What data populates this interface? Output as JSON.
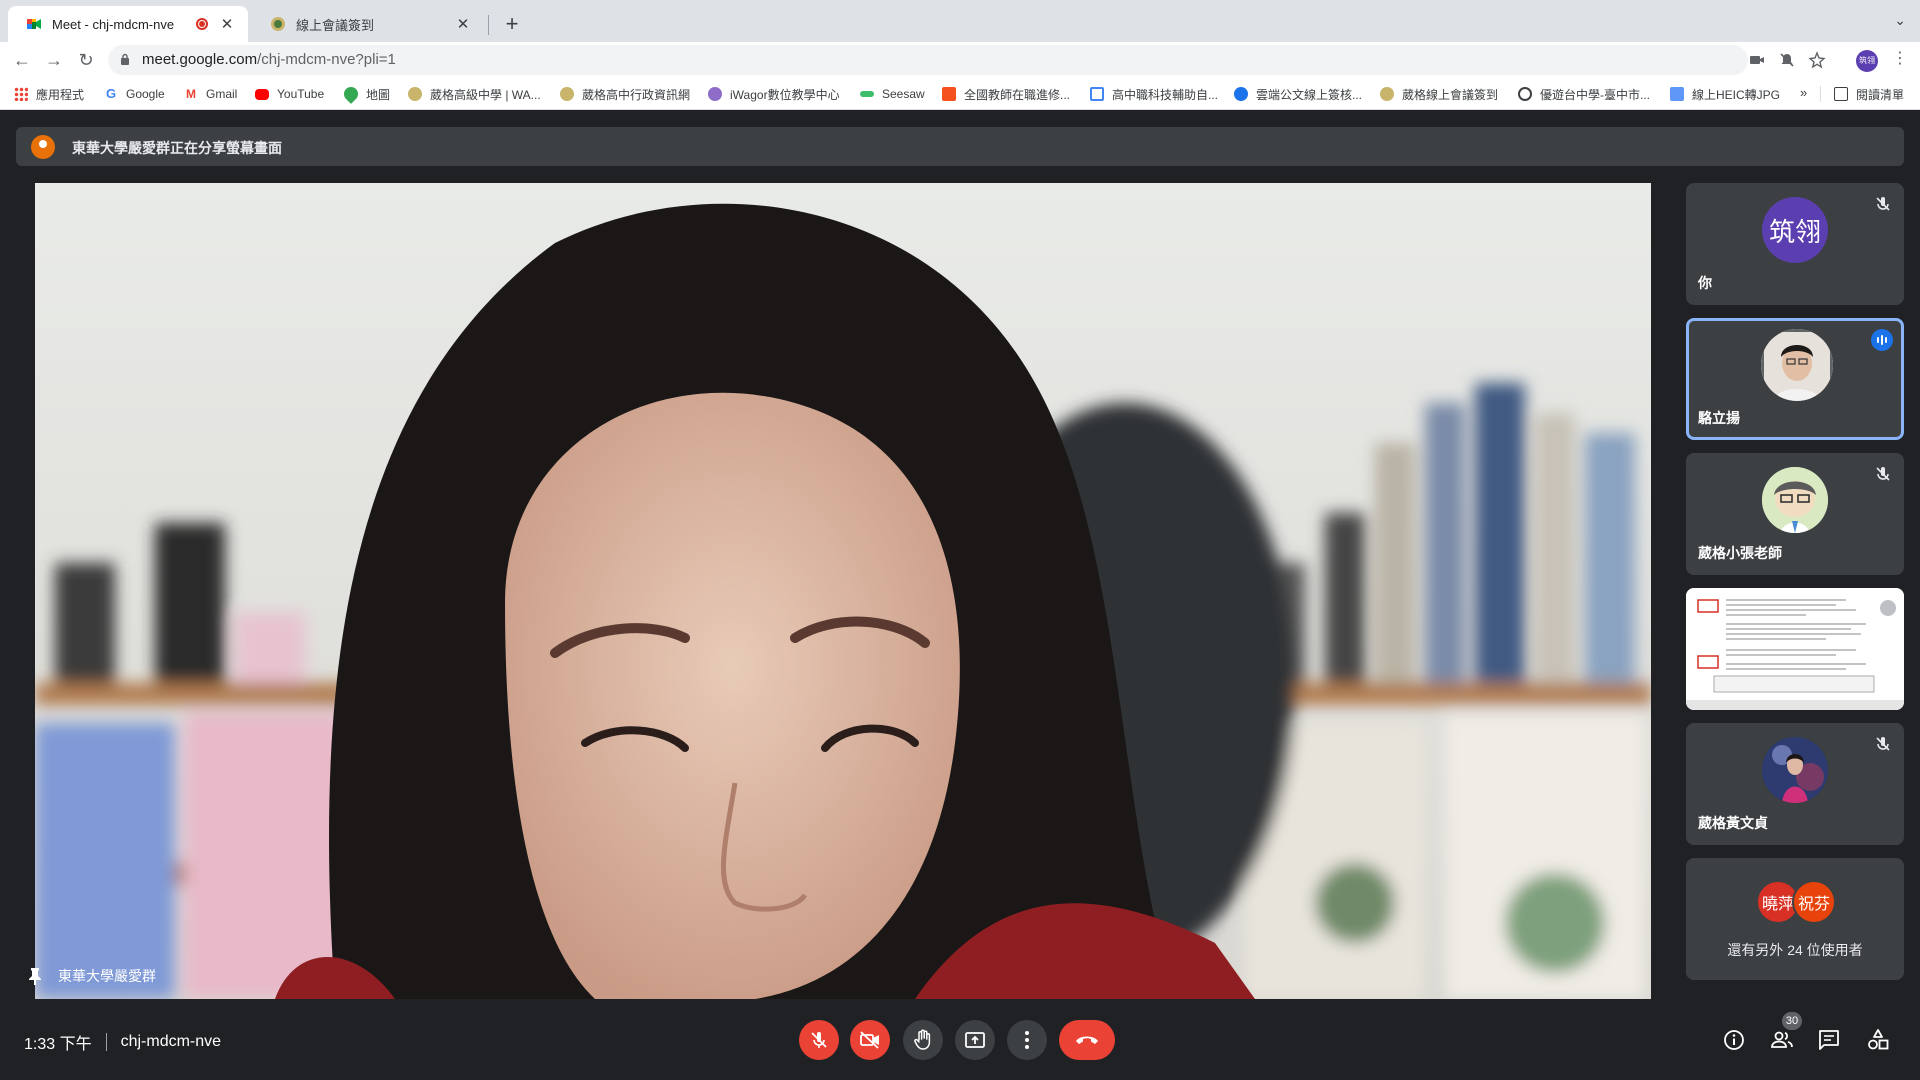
{
  "browser": {
    "tabs": [
      {
        "title": "Meet - chj-mdcm-nve",
        "active": true
      },
      {
        "title": "線上會議簽到",
        "active": false
      }
    ],
    "url_host": "meet.google.com",
    "url_path": "/chj-mdcm-nve?pli=1",
    "profile_initials": "筑翎",
    "bookmarks": [
      "應用程式",
      "Google",
      "Gmail",
      "YouTube",
      "地圖",
      "葳格高級中學 | WA...",
      "葳格高中行政資訊網",
      "iWagor數位教學中心",
      "Seesaw",
      "全國教師在職進修...",
      "高中職科技輔助自...",
      "雲端公文線上簽核...",
      "葳格線上會議簽到",
      "優遊台中學-臺中市...",
      "線上HEIC轉JPG"
    ],
    "more_bookmarks": "»",
    "reading_list": "閱讀清單"
  },
  "meet": {
    "presenting_banner": "東華大學嚴愛群正在分享螢幕畫面",
    "main_speaker": "東華大學嚴愛群",
    "participants": [
      {
        "name": "你",
        "initials": "筑翎",
        "avatar_color": "#5b3fb0",
        "muted": true
      },
      {
        "name": "駱立揚",
        "muted": false,
        "speaking": true
      },
      {
        "name": "葳格小張老師",
        "muted": true
      },
      {
        "name": "",
        "screen_share": true
      },
      {
        "name": "葳格黃文貞",
        "muted": true
      }
    ],
    "others": {
      "avatars": [
        {
          "initials": "曉萍",
          "color": "#d93025"
        },
        {
          "initials": "祝芬",
          "color": "#e8430a"
        }
      ],
      "text": "還有另外 24 位使用者"
    },
    "time": "1:33 下午",
    "meeting_code": "chj-mdcm-nve",
    "participant_count": "30"
  }
}
